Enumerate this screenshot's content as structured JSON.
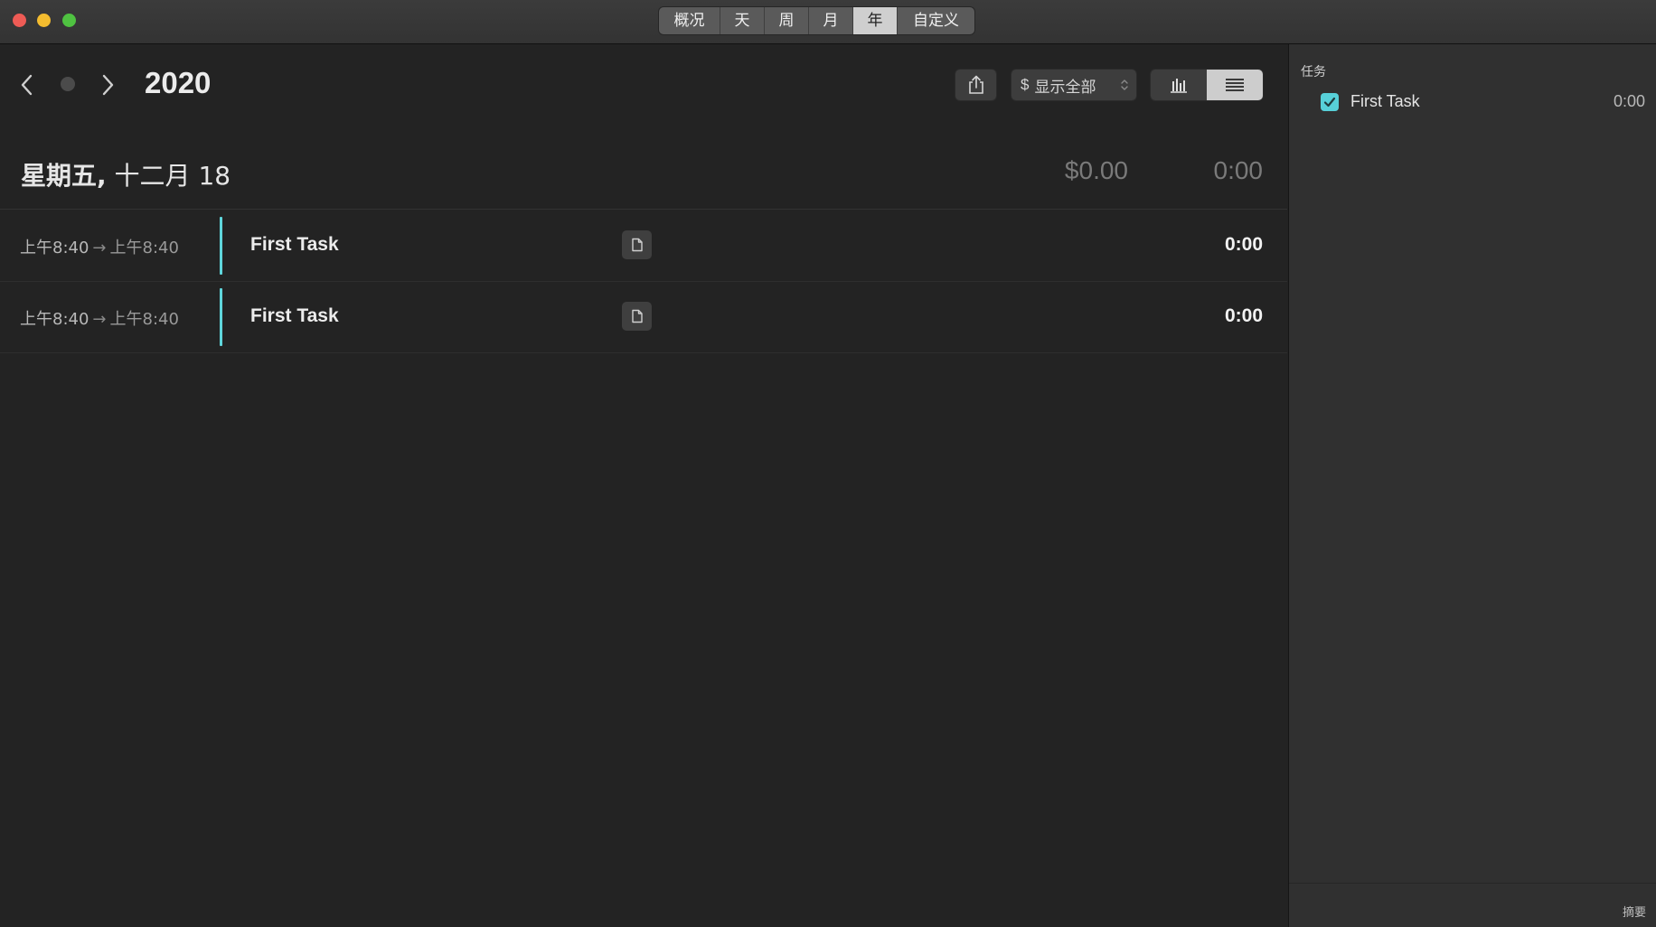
{
  "window": {
    "tabs": [
      {
        "label": "概况"
      },
      {
        "label": "天"
      },
      {
        "label": "周"
      },
      {
        "label": "月"
      },
      {
        "label": "年",
        "active": true
      },
      {
        "label": "自定义"
      }
    ]
  },
  "toolbar": {
    "year": "2020",
    "filter_currency": "$",
    "filter_label": "显示全部",
    "share_icon": "share-icon",
    "chart_view_icon": "bar-chart-icon",
    "list_view_icon": "list-icon",
    "active_view": "list"
  },
  "day": {
    "weekday": "星期五,",
    "date": "十二月 18",
    "amount": "$0.00",
    "total": "0:00"
  },
  "entries": [
    {
      "start": "上午8:40",
      "arrow": "→",
      "end": "上午8:40",
      "task": "First Task",
      "duration": "0:00",
      "note_icon": "note-icon"
    },
    {
      "start": "上午8:40",
      "arrow": "→",
      "end": "上午8:40",
      "task": "First Task",
      "duration": "0:00",
      "note_icon": "note-icon"
    }
  ],
  "sidebar": {
    "heading": "任务",
    "tasks": [
      {
        "label": "First Task",
        "time": "0:00",
        "checked": true
      }
    ],
    "footer_label": "摘要"
  },
  "colors": {
    "accent": "#5fd6dc",
    "background": "#232323",
    "sidebar": "#303030"
  }
}
